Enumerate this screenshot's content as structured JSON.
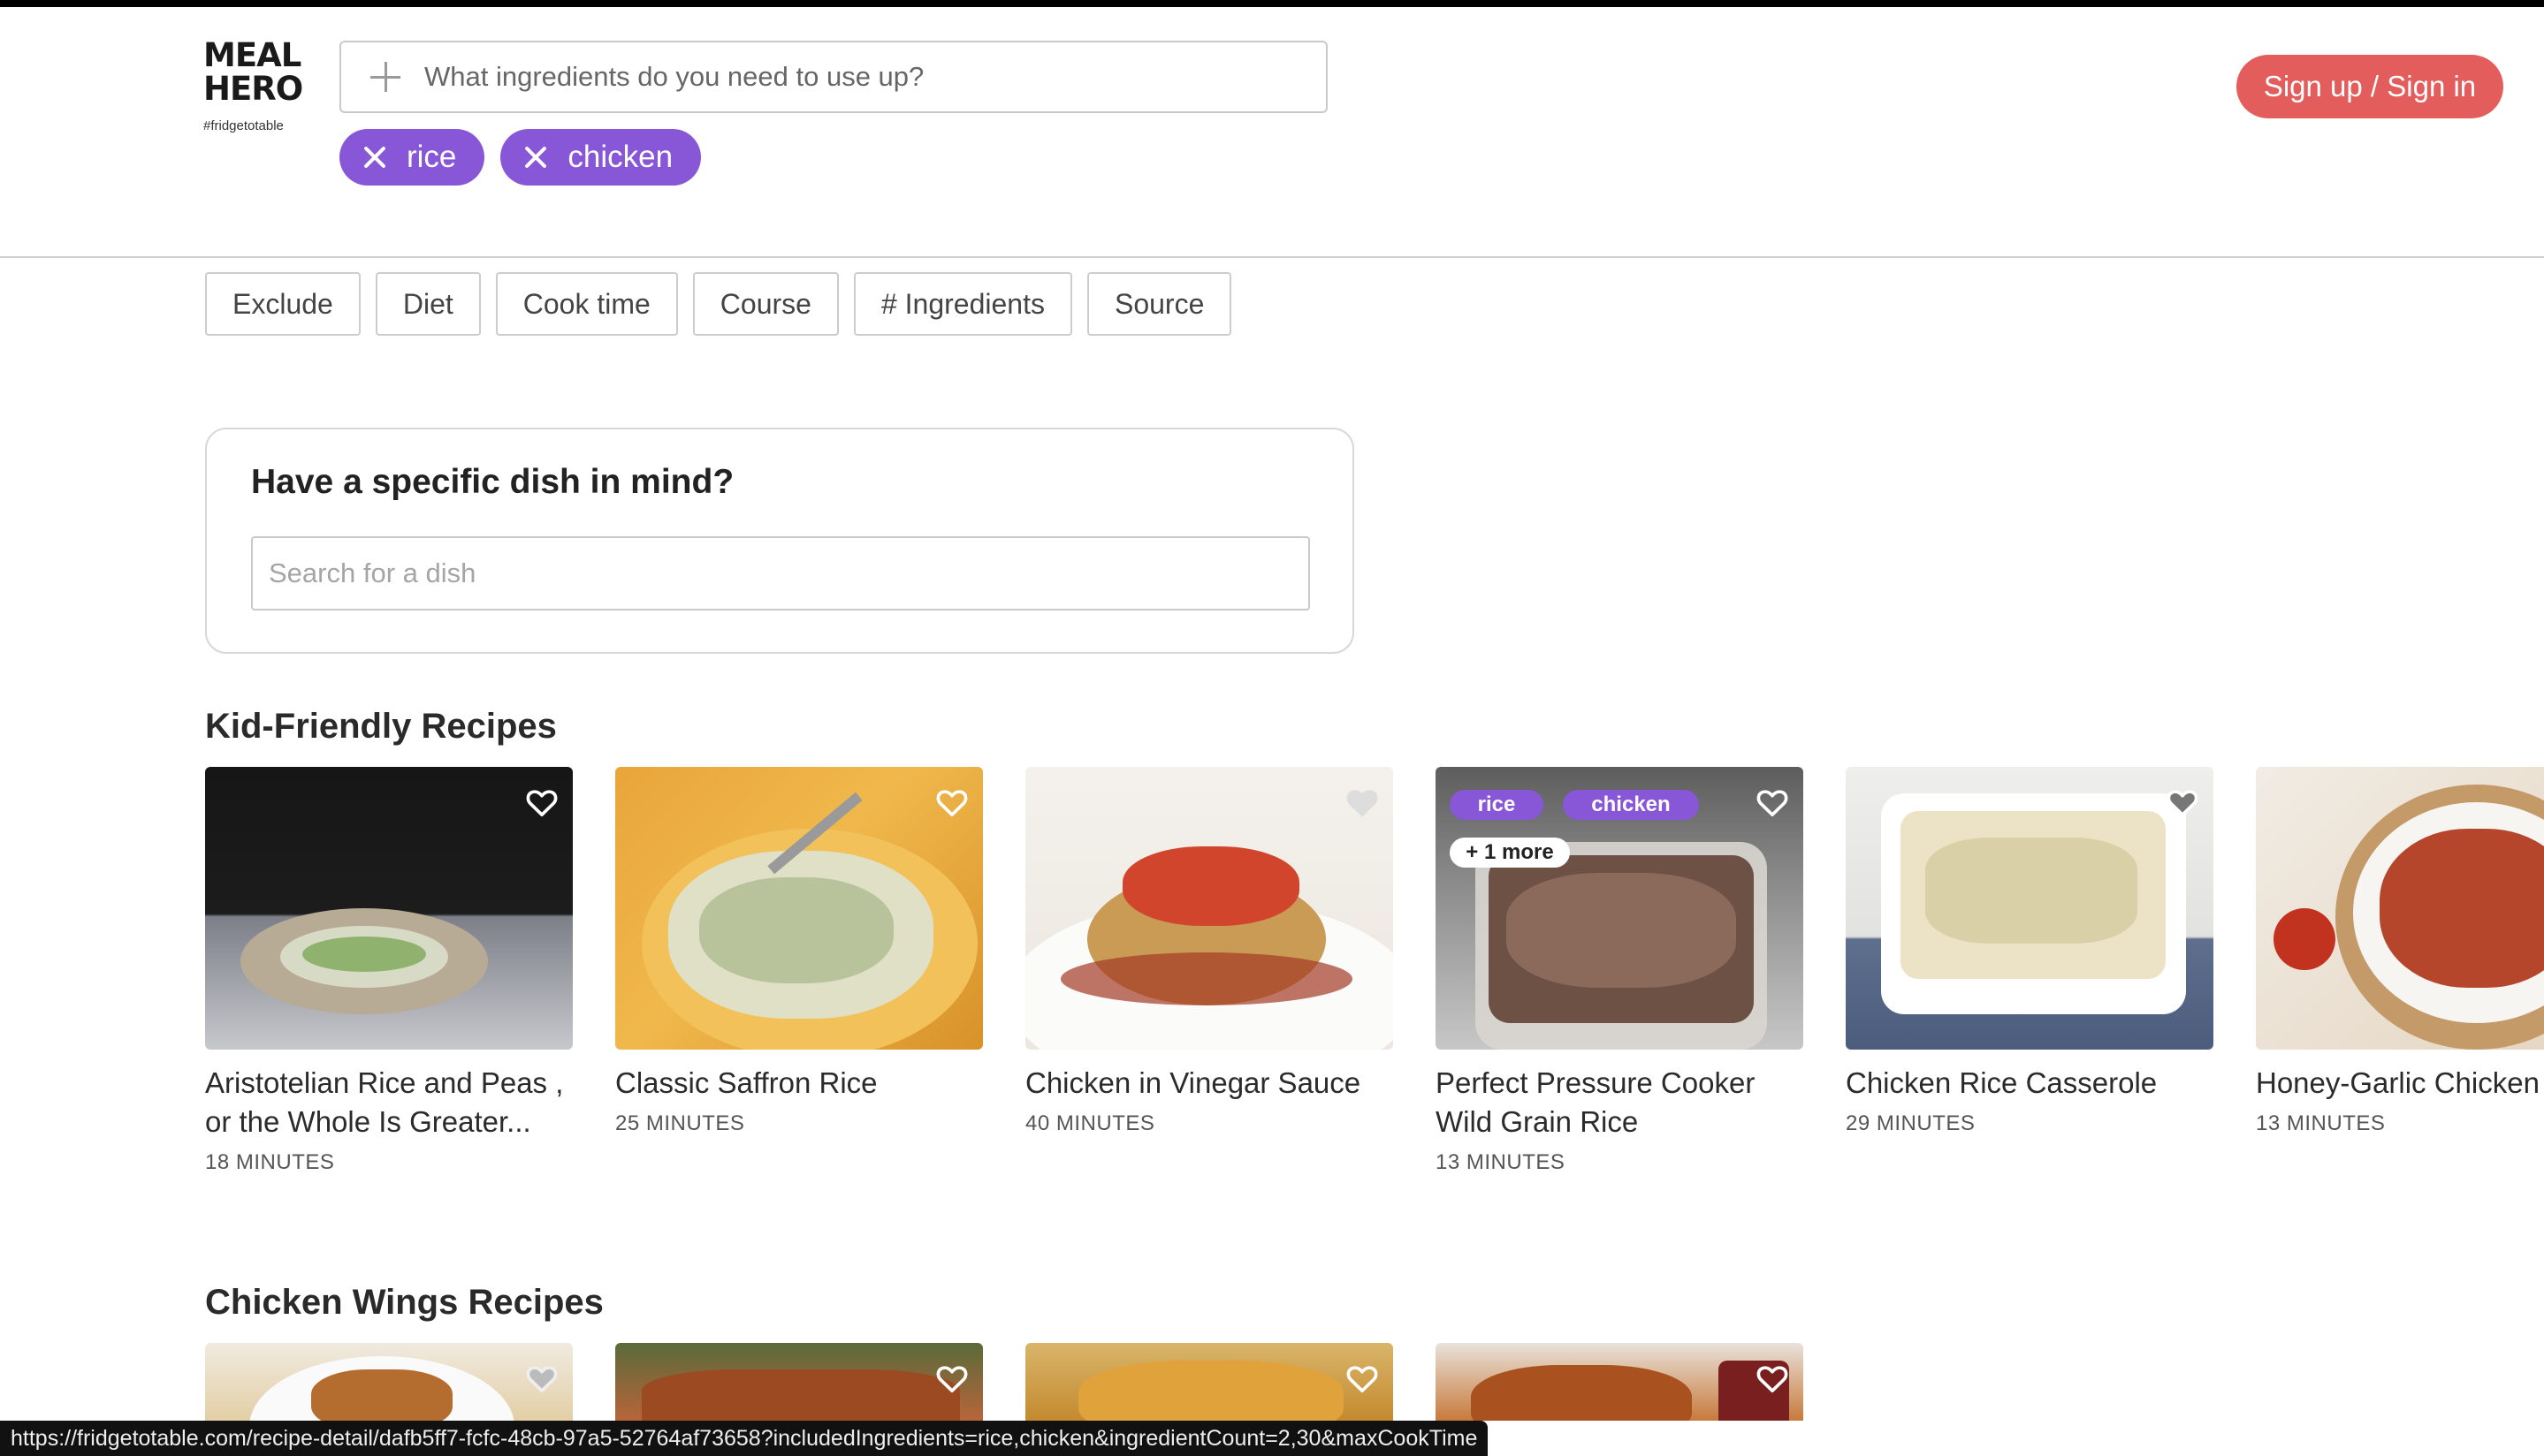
{
  "logo": {
    "line1": "MEAL",
    "line2": "HERO",
    "tagline": "#fridgetotable"
  },
  "ingredient_search": {
    "placeholder": "What ingredients do you need to use up?"
  },
  "chips": [
    {
      "label": "rice"
    },
    {
      "label": "chicken"
    }
  ],
  "header": {
    "signin_label": "Sign up / Sign in"
  },
  "filters": [
    "Exclude",
    "Diet",
    "Cook time",
    "Course",
    "# Ingredients",
    "Source"
  ],
  "dish_search": {
    "title": "Have a specific dish in mind?",
    "placeholder": "Search for a dish"
  },
  "sections": [
    {
      "title": "Kid-Friendly Recipes",
      "recipes": [
        {
          "name": "Aristotelian Rice and Peas , or the Whole Is Greater...",
          "time": "18 MINUTES"
        },
        {
          "name": "Classic Saffron Rice",
          "time": "25 MINUTES"
        },
        {
          "name": "Chicken in Vinegar Sauce",
          "time": "40 MINUTES"
        },
        {
          "name": "Perfect Pressure Cooker Wild Grain Rice",
          "time": "13 MINUTES",
          "badges": [
            "rice",
            "chicken"
          ],
          "more": "+ 1 more"
        },
        {
          "name": "Chicken Rice Casserole",
          "time": "29 MINUTES"
        },
        {
          "name": "Honey-Garlic Chicken Sweet Pepper Stir-Fry",
          "time": "13 MINUTES"
        }
      ]
    },
    {
      "title": "Chicken Wings Recipes"
    }
  ],
  "status_url": "https://fridgetotable.com/recipe-detail/dafb5ff7-fcfc-48cb-97a5-52764af73658?includedIngredients=rice,chicken&ingredientCount=2,30&maxCookTime",
  "icons": {
    "heart": "heart-outline-icon",
    "add": "plus-icon",
    "remove": "close-icon"
  },
  "colors": {
    "accent": "#8757d8",
    "signin": "#e45d5d"
  }
}
